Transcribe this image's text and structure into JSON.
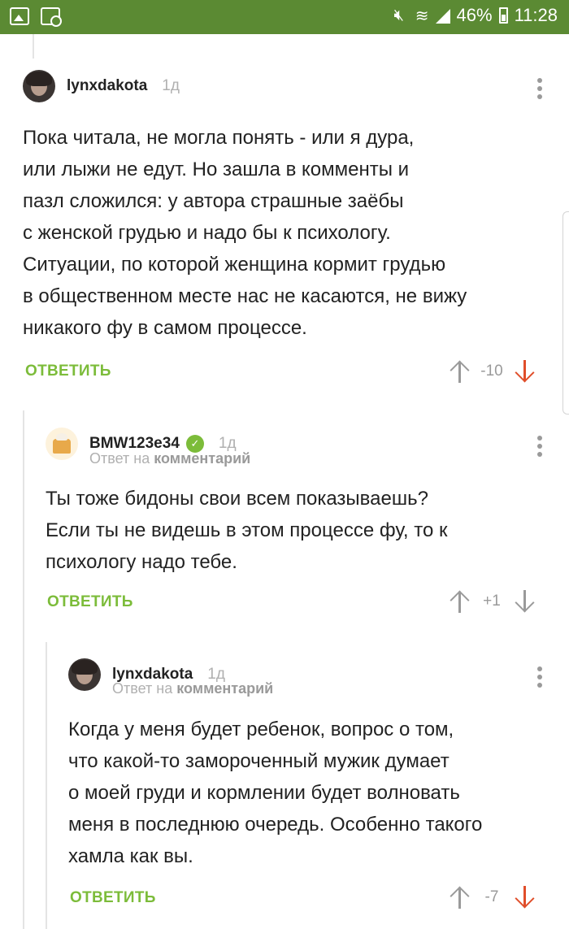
{
  "status_bar": {
    "battery": "46%",
    "time": "11:28"
  },
  "comments": [
    {
      "username": "lynxdakota",
      "time": "1д",
      "reply_to_prefix": "",
      "reply_to_link": "",
      "text_lines": [
        "Пока читала, не могла понять - или я дура,",
        "или лыжи не едут. Но зашла в комменты и",
        "пазл сложился: у автора страшные заёбы",
        "с женской грудью и надо бы к психологу.",
        "Ситуации, по которой женщина кормит грудью",
        "в общественном месте нас не касаются, не вижу",
        "никакого фу в самом процессе."
      ],
      "reply_label": "ОТВЕТИТЬ",
      "score": "-10"
    },
    {
      "username": "BMW123e34",
      "time": "1д",
      "reply_to_prefix": "Ответ на",
      "reply_to_link": "комментарий",
      "text_lines": [
        "Ты тоже бидоны свои всем показываешь?",
        "Если ты не видешь в этом процессе фу, то к",
        "психологу надо тебе."
      ],
      "reply_label": "ОТВЕТИТЬ",
      "score": "+1"
    },
    {
      "username": "lynxdakota",
      "time": "1д",
      "reply_to_prefix": "Ответ на",
      "reply_to_link": "комментарий",
      "text_lines": [
        "Когда у меня будет ребенок, вопрос о том,",
        "что какой-то замороченный мужик думает",
        "о моей груди и кормлении будет волновать",
        "меня в последнюю очередь. Особенно такого",
        "хамла как вы."
      ],
      "reply_label": "ОТВЕТИТЬ",
      "score": "-7"
    }
  ],
  "colors": {
    "status_bar": "#5b8a33",
    "accent_green": "#7cbc3a",
    "downvote_active": "#e04e2a"
  }
}
